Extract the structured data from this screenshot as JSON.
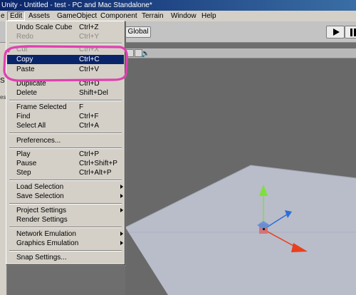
{
  "window": {
    "title": "Unity - Untitled - test - PC and Mac Standalone*"
  },
  "menubar": {
    "items": [
      {
        "label": "File",
        "visible": "e"
      },
      {
        "label": "Edit"
      },
      {
        "label": "Assets"
      },
      {
        "label": "GameObject"
      },
      {
        "label": "Component"
      },
      {
        "label": "Terrain"
      },
      {
        "label": "Window"
      },
      {
        "label": "Help"
      }
    ]
  },
  "toolbar": {
    "global_label": "Global",
    "play_icon": "play-icon",
    "pause_icon": "pause-icon"
  },
  "left_panel": {
    "tab_s": "S",
    "tab_st": "est"
  },
  "scene": {
    "speaker_icon": "speaker-icon"
  },
  "edit_menu": {
    "groups": [
      [
        {
          "label": "Undo Scale Cube",
          "shortcut": "Ctrl+Z",
          "enabled": true
        },
        {
          "label": "Redo",
          "shortcut": "Ctrl+Y",
          "enabled": false
        }
      ],
      [
        {
          "label": "Cut",
          "shortcut": "Ctrl+X",
          "enabled": false
        },
        {
          "label": "Copy",
          "shortcut": "Ctrl+C",
          "enabled": true,
          "highlighted": true
        },
        {
          "label": "Paste",
          "shortcut": "Ctrl+V",
          "enabled": true
        },
        {
          "label": "Duplicate",
          "shortcut": "Ctrl+D",
          "enabled": true
        },
        {
          "label": "Delete",
          "shortcut": "Shift+Del",
          "enabled": true
        }
      ],
      [
        {
          "label": "Frame Selected",
          "shortcut": "F",
          "enabled": true
        },
        {
          "label": "Find",
          "shortcut": "Ctrl+F",
          "enabled": true
        },
        {
          "label": "Select All",
          "shortcut": "Ctrl+A",
          "enabled": true
        }
      ],
      [
        {
          "label": "Preferences...",
          "shortcut": "",
          "enabled": true
        }
      ],
      [
        {
          "label": "Play",
          "shortcut": "Ctrl+P",
          "enabled": true
        },
        {
          "label": "Pause",
          "shortcut": "Ctrl+Shift+P",
          "enabled": true
        },
        {
          "label": "Step",
          "shortcut": "Ctrl+Alt+P",
          "enabled": true
        }
      ],
      [
        {
          "label": "Load Selection",
          "shortcut": "",
          "submenu": true,
          "enabled": true
        },
        {
          "label": "Save Selection",
          "shortcut": "",
          "submenu": true,
          "enabled": true
        }
      ],
      [
        {
          "label": "Project Settings",
          "shortcut": "",
          "submenu": true,
          "enabled": true
        },
        {
          "label": "Render Settings",
          "shortcut": "",
          "enabled": true
        }
      ],
      [
        {
          "label": "Network Emulation",
          "shortcut": "",
          "submenu": true,
          "enabled": true
        },
        {
          "label": "Graphics Emulation",
          "shortcut": "",
          "submenu": true,
          "enabled": true
        }
      ],
      [
        {
          "label": "Snap Settings...",
          "shortcut": "",
          "enabled": true
        }
      ]
    ]
  },
  "annotation": {
    "color": "#e040b0",
    "target": "Copy / Paste"
  },
  "colors": {
    "highlight": "#0a246a",
    "gizmo_y": "#7ee03a",
    "gizmo_z": "#2a6fd8",
    "gizmo_x": "#e8401c",
    "plane": "#b9bcc9"
  }
}
